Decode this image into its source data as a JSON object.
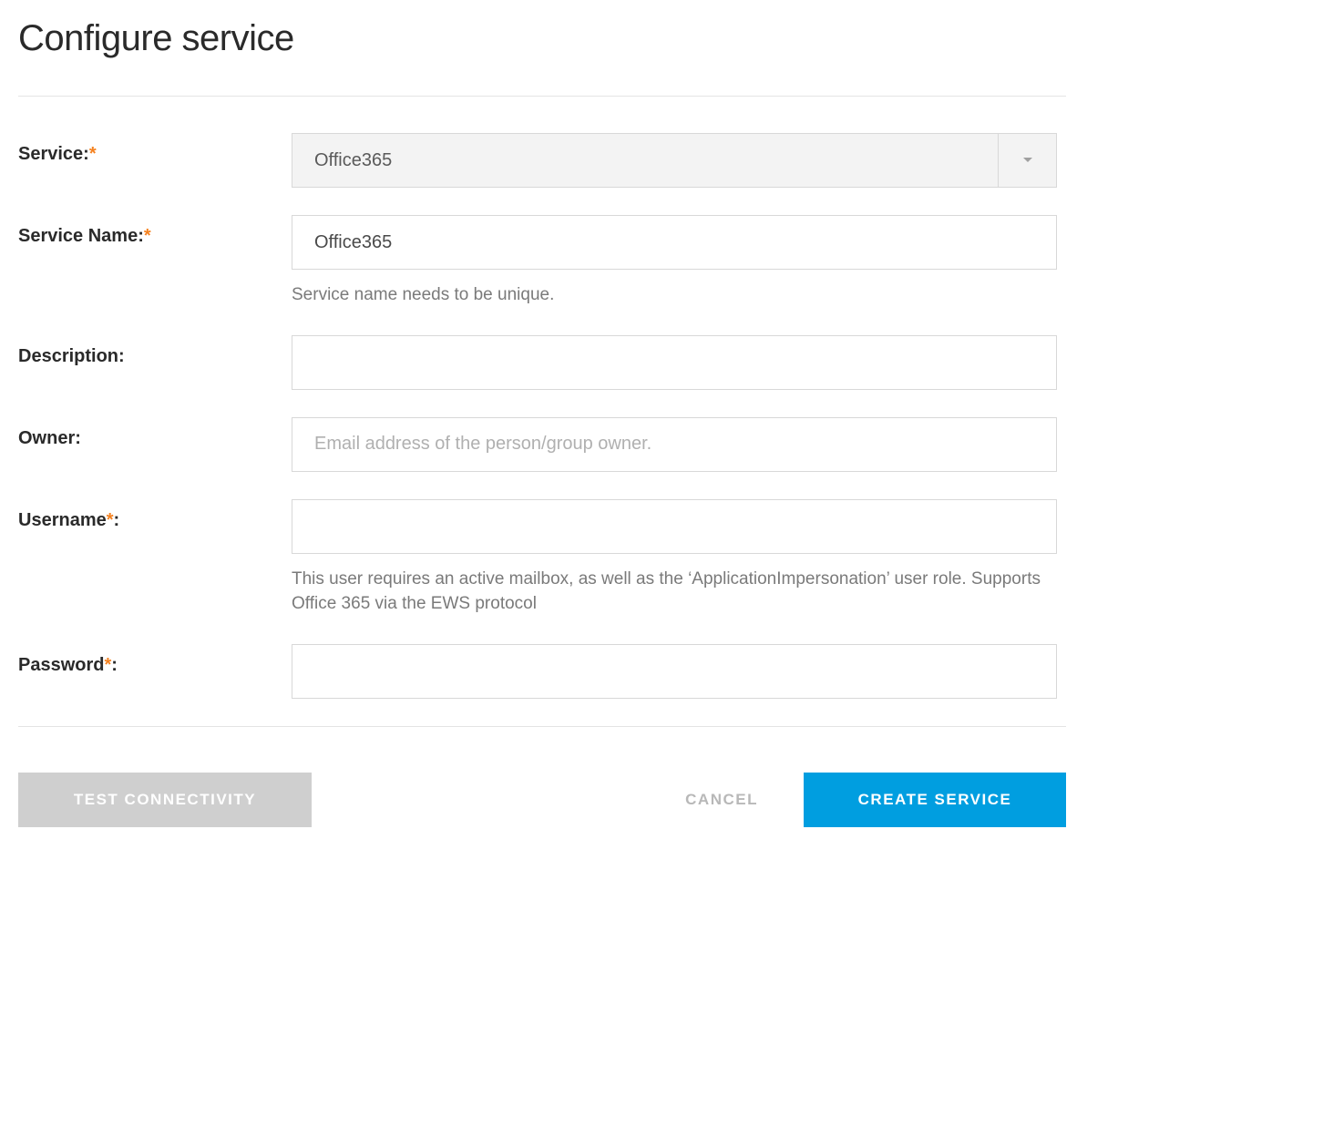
{
  "title": "Configure service",
  "fields": {
    "service": {
      "label": "Service:",
      "value": "Office365"
    },
    "serviceName": {
      "label": "Service Name:",
      "value": "Office365",
      "help": "Service name needs to be unique."
    },
    "description": {
      "label": "Description:",
      "value": ""
    },
    "owner": {
      "label": "Owner:",
      "value": "",
      "placeholder": "Email address of the person/group owner."
    },
    "username": {
      "label": "Username",
      "value": "",
      "help": "This user requires an active mailbox, as well as the ‘ApplicationImpersonation’ user role. Supports Office 365 via the EWS protocol"
    },
    "password": {
      "label": "Password",
      "value": ""
    }
  },
  "requiredMark": "*",
  "colon": ":",
  "buttons": {
    "test": "TEST CONNECTIVITY",
    "cancel": "CANCEL",
    "create": "CREATE SERVICE"
  }
}
